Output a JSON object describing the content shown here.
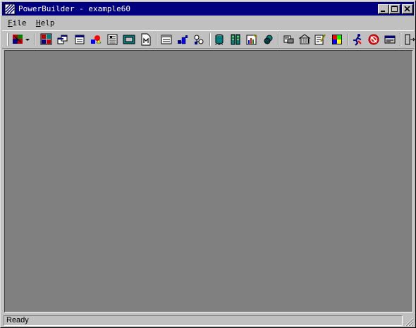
{
  "window": {
    "title": "PowerBuilder - example60"
  },
  "menu": [
    {
      "label": "File",
      "accel": "F",
      "rest": "ile"
    },
    {
      "label": "Help",
      "accel": "H",
      "rest": "elp"
    }
  ],
  "toolbar_icons": [
    "new-icon",
    "dropdown-arrow-icon",
    "application-icon",
    "window-painter-icon",
    "menu-painter-icon",
    "structure-icon",
    "datawindow-icon",
    "function-icon",
    "user-object-icon",
    "query-icon",
    "pipeline-icon",
    "project-icon",
    "database-icon",
    "db-profile-icon",
    "report-icon",
    "library-icon",
    "browser-icon",
    "debug-icon",
    "edit-icon",
    "color-icon",
    "run-icon",
    "stop-icon",
    "compile-icon",
    "exit-icon"
  ],
  "status": {
    "text": "Ready"
  },
  "colors": {
    "titlebar": "#000080",
    "client": "#808080",
    "chrome": "#c0c0c0"
  }
}
